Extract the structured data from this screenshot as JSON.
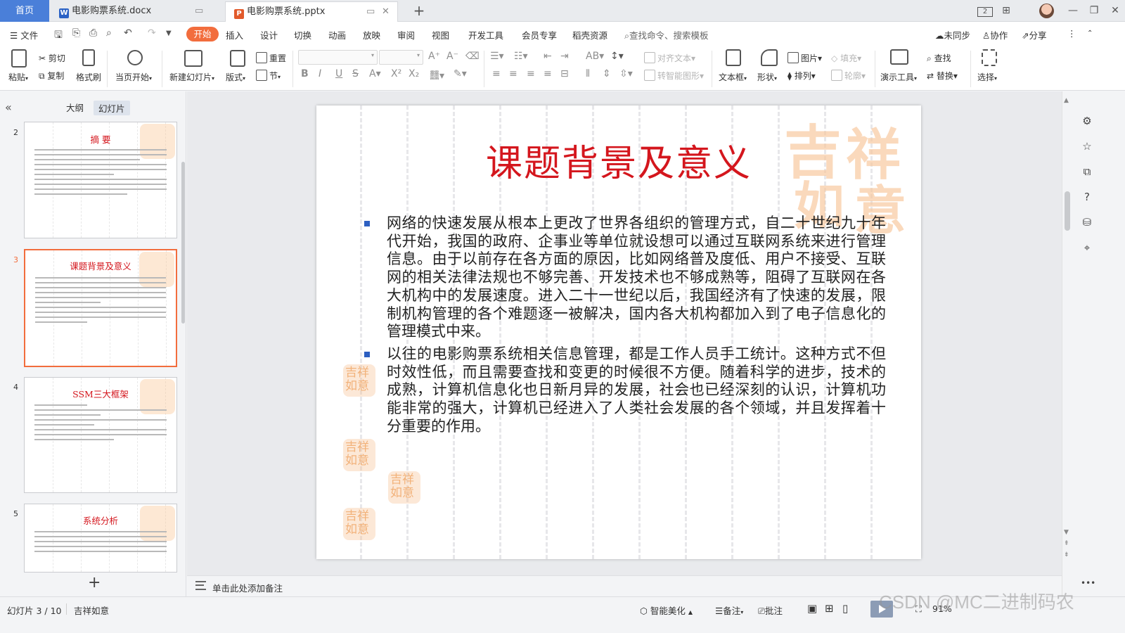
{
  "tabbar": {
    "home": "首页",
    "tabs": [
      {
        "name": "电影购票系统.docx",
        "type": "word",
        "active": false
      },
      {
        "name": "电影购票系统.pptx",
        "type": "ppt",
        "active": true
      }
    ],
    "new_tab": "+",
    "win": {
      "layout": "2",
      "grid": "⊞",
      "minimize": "—",
      "restore": "❐",
      "close": "✕"
    }
  },
  "menubar": {
    "file": "文件",
    "items": [
      "开始",
      "插入",
      "设计",
      "切换",
      "动画",
      "放映",
      "审阅",
      "视图",
      "开发工具",
      "会员专享",
      "稻壳资源"
    ],
    "search": "查找命令、搜索模板",
    "sync": "未同步",
    "collab": "协作",
    "share": "分享"
  },
  "ribbon": {
    "paste": "粘贴",
    "cut": "剪切",
    "copy": "复制",
    "format_painter": "格式刷",
    "from_current": "当页开始",
    "new_slide": "新建幻灯片",
    "layout": "版式",
    "reset": "重置",
    "section": "节",
    "align_text": "对齐文本",
    "smart_shape": "转智能图形",
    "text_box": "文本框",
    "shape": "形状",
    "picture": "图片",
    "arrange": "排列",
    "fill": "填充",
    "outline": "轮廓",
    "presenter": "演示工具",
    "find": "查找",
    "replace": "替换",
    "select": "选择"
  },
  "leftpanel": {
    "tab_outline": "大纲",
    "tab_slides": "幻灯片",
    "thumbs": [
      {
        "num": "2",
        "title": "摘  要"
      },
      {
        "num": "3",
        "title": "课题背景及意义"
      },
      {
        "num": "4",
        "title": "SSM三大框架"
      },
      {
        "num": "5",
        "title": "系统分析"
      }
    ],
    "add": "+"
  },
  "slide": {
    "title": "课题背景及意义",
    "paragraphs": [
      "网络的快速发展从根本上更改了世界各组织的管理方式，自二十世纪九十年代开始，我国的政府、企事业等单位就设想可以通过互联网系统来进行管理信息。由于以前存在各方面的原因，比如网络普及度低、用户不接受、互联网的相关法律法规也不够完善、开发技术也不够成熟等，阻碍了互联网在各大机构中的发展速度。进入二十一世纪以后，我国经济有了快速的发展，限制机构管理的各个难题逐一被解决，国内各大机构都加入到了电子信息化的管理模式中来。",
      "以往的电影购票系统相关信息管理，都是工作人员手工统计。这种方式不但时效性低，而且需要查找和变更的时候很不方便。随着科学的进步，技术的成熟，计算机信息化也日新月异的发展，社会也已经深刻的认识，计算机功能非常的强大，计算机已经进入了人类社会发展的各个领域，并且发挥着十分重要的作用。"
    ],
    "seal_text": "吉祥如意"
  },
  "notes": {
    "placeholder": "单击此处添加备注"
  },
  "statusbar": {
    "slide_info": "幻灯片 3 / 10",
    "theme": "吉祥如意",
    "beautify": "智能美化",
    "notes": "备注",
    "comments": "批注",
    "zoom": "91%"
  },
  "watermark": "CSDN @MC二进制码农",
  "colors": {
    "accent": "#f26d3d",
    "title_red": "#d4161d",
    "bullet_blue": "#2c5fc1",
    "home_tab": "#4a7fd9"
  }
}
